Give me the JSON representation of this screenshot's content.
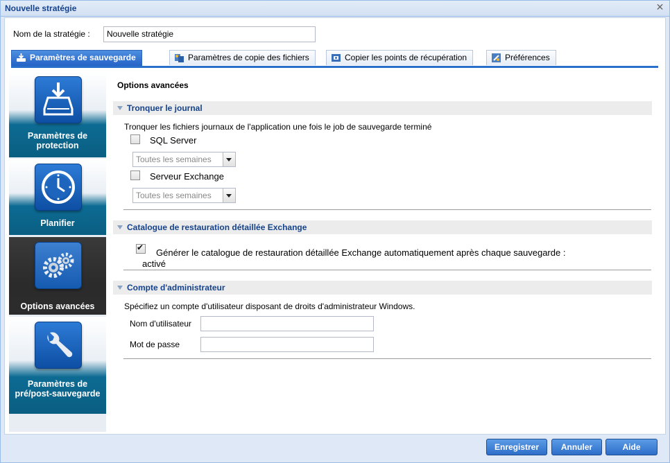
{
  "window": {
    "title": "Nouvelle stratégie"
  },
  "strategy": {
    "name_label": "Nom de la stratégie :",
    "name_value": "Nouvelle stratégie"
  },
  "tabs": [
    {
      "label": "Paramètres de sauvegarde",
      "icon": "backup-icon",
      "active": true
    },
    {
      "label": "Paramètres de copie des fichiers",
      "icon": "file-copy-icon",
      "active": false
    },
    {
      "label": "Copier les points de récupération",
      "icon": "recovery-copy-icon",
      "active": false
    },
    {
      "label": "Préférences",
      "icon": "preferences-icon",
      "active": false
    }
  ],
  "sidebar": {
    "items": [
      {
        "label": "Paramètres de protection",
        "icon": "drive-download-icon",
        "active": false
      },
      {
        "label": "Planifier",
        "icon": "clock-icon",
        "active": false
      },
      {
        "label": "Options avancées",
        "icon": "gears-icon",
        "active": true
      },
      {
        "label": "Paramètres de pré/post-sauvegarde",
        "icon": "wrench-icon",
        "active": false
      }
    ]
  },
  "main": {
    "title": "Options avancées",
    "truncate": {
      "title": "Tronquer le journal",
      "description": "Tronquer les fichiers journaux de l'application une fois le job de sauvegarde terminé",
      "sql": {
        "label": "SQL Server",
        "checked": false,
        "frequency": "Toutes les semaines"
      },
      "exchange": {
        "label": "Serveur Exchange",
        "checked": false,
        "frequency": "Toutes les semaines"
      }
    },
    "catalog": {
      "title": "Catalogue de restauration détaillée Exchange",
      "checkbox_label": "Générer le catalogue de restauration détaillée Exchange automatiquement après chaque sauvegarde :",
      "status": "activé",
      "checked": true
    },
    "admin": {
      "title": "Compte d'administrateur",
      "description": "Spécifiez un compte d'utilisateur disposant de droits d'administrateur Windows.",
      "username_label": "Nom d'utilisateur",
      "username_value": "",
      "password_label": "Mot de passe",
      "password_value": ""
    }
  },
  "footer": {
    "save_label": "Enregistrer",
    "cancel_label": "Annuler",
    "help_label": "Aide"
  },
  "colors": {
    "accent": "#2a6fc9",
    "section_title": "#15428b",
    "sidebar_teal": "#0a5e82"
  }
}
